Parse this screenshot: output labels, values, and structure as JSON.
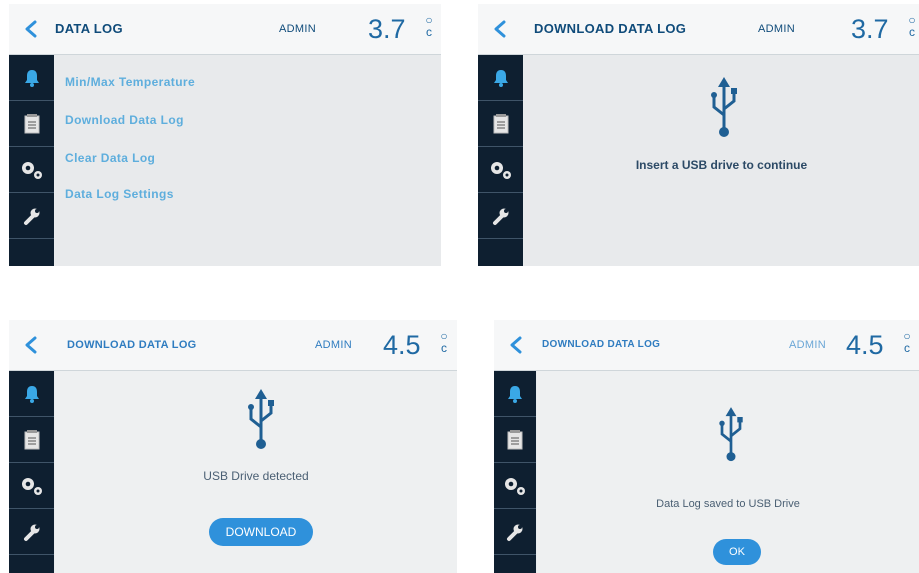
{
  "panels": [
    {
      "header": {
        "title": "DATA LOG",
        "user": "ADMIN",
        "temp": "3.7",
        "unit_top": "○",
        "unit_bottom": "c"
      },
      "menu": [
        "Min/Max Temperature",
        "Download Data Log",
        "Clear Data Log",
        "Data Log Settings"
      ]
    },
    {
      "header": {
        "title": "DOWNLOAD DATA LOG",
        "user": "ADMIN",
        "temp": "3.7",
        "unit_top": "○",
        "unit_bottom": "c"
      },
      "message": "Insert a USB drive to continue"
    },
    {
      "header": {
        "title": "DOWNLOAD DATA LOG",
        "user": "ADMIN",
        "temp": "4.5",
        "unit_top": "○",
        "unit_bottom": "c"
      },
      "message": "USB Drive detected",
      "button": "DOWNLOAD"
    },
    {
      "header": {
        "title": "DOWNLOAD DATA LOG",
        "user": "ADMIN",
        "temp": "4.5",
        "unit_top": "○",
        "unit_bottom": "c"
      },
      "message": "Data Log saved to USB Drive",
      "button": "OK"
    }
  ],
  "icons": {
    "back": "chevron-left-icon",
    "sidebar": [
      "bell-icon",
      "notepad-icon",
      "gears-icon",
      "wrench-icon"
    ],
    "usb": "usb-icon"
  },
  "colors": {
    "accent": "#1f69a3",
    "sidebar": "#0e1f30",
    "button": "#2f91db",
    "menu_text": "#5eaedd"
  }
}
